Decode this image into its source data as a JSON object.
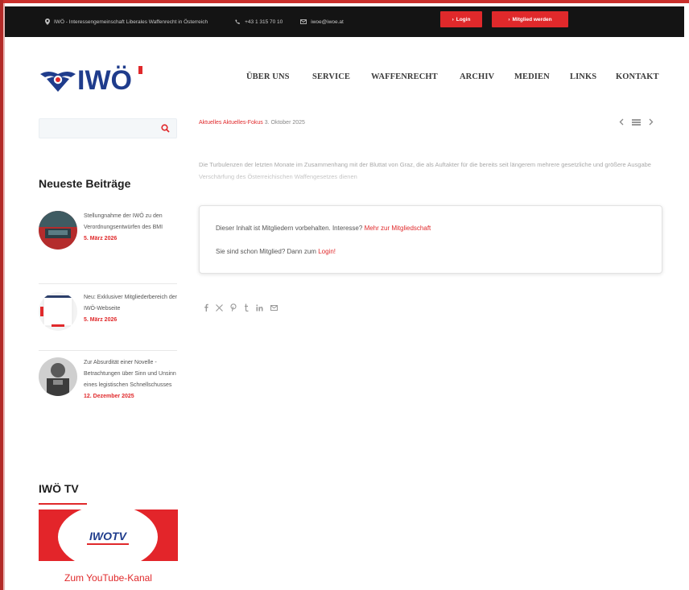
{
  "topbar": {
    "org_text": "IWÖ - Interessengemeinschaft Liberales Waffenrecht in Österreich",
    "phone": "+43 1 315 70 10",
    "email": "iwoe@iwoe.at",
    "login_label": "Login",
    "member_label": "Mitglied werden",
    "icons": [
      "location-icon",
      "phone-icon",
      "mail-icon"
    ]
  },
  "brand": {
    "logo_text": "IWÖ"
  },
  "nav": {
    "items": [
      "ÜBER UNS",
      "SERVICE",
      "WAFFENRECHT",
      "ARCHIV",
      "MEDIEN",
      "LINKS",
      "KONTAKT"
    ]
  },
  "search": {
    "placeholder": ""
  },
  "sidebar": {
    "recent_title": "Neueste Beiträge",
    "posts": [
      {
        "title": "Stellungnahme der IWÖ zu den Verordnungsentwürfen des BMI",
        "date": "5. März 2026"
      },
      {
        "title": "Neu: Exklusiver Mitgliederbereich der IWÖ-Webseite",
        "date": "5. März 2026"
      },
      {
        "title": "Zur Absurdität einer Novelle - Betrachtungen über Sinn und Unsinn eines legistischen Schnellschusses",
        "date": "12. Dezember 2025"
      }
    ],
    "tv_title": "IWÖ TV",
    "tv_logo_text": "IWOTV",
    "tv_link": "Zum YouTube-Kanal"
  },
  "post": {
    "categories": "Aktuelles Aktuelles-Fokus",
    "date": "3. Oktober 2025",
    "excerpt": "Die Turbulenzen der letzten Monate im Zusammenhang mit der Bluttat von Graz, die als Auftakter für die bereits seit längerem mehrere gesetzliche und größere Ausgabe Verschärfung des Österreichischen Waffengesetzes dienen",
    "restricted_text": "Dieser Inhalt ist Mitgliedern vorbehalten. Interesse?",
    "restricted_link": "Mehr zur Mitgliedschaft",
    "login_prompt": "Sie sind schon Mitglied? Dann zum",
    "login_link": "Login!"
  },
  "share_icons": [
    "facebook-icon",
    "x-icon",
    "pinterest-icon",
    "tumblr-icon",
    "linkedin-icon",
    "email-icon"
  ],
  "colors": {
    "accent": "#e0292b",
    "topbar_bg": "#141414",
    "logo_blue": "#1f3c8c"
  }
}
